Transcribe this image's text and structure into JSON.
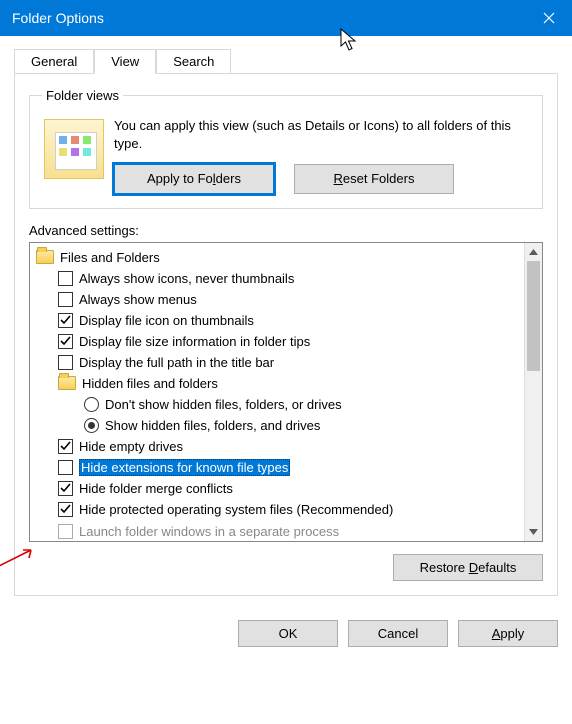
{
  "titlebar": {
    "title": "Folder Options"
  },
  "tabs": {
    "general": "General",
    "view": "View",
    "search": "Search"
  },
  "folder_views": {
    "legend": "Folder views",
    "desc": "You can apply this view (such as Details or Icons) to all folders of this type.",
    "apply_pre": "Apply to Fo",
    "apply_m": "l",
    "apply_post": "ders",
    "reset_m": "R",
    "reset_post": "eset Folders"
  },
  "advanced": {
    "label": "Advanced settings:",
    "group_files_folders": "Files and Folders",
    "items": [
      {
        "type": "check",
        "label": "Always show icons, never thumbnails",
        "checked": false
      },
      {
        "type": "check",
        "label": "Always show menus",
        "checked": false
      },
      {
        "type": "check",
        "label": "Display file icon on thumbnails",
        "checked": true
      },
      {
        "type": "check",
        "label": "Display file size information in folder tips",
        "checked": true
      },
      {
        "type": "check",
        "label": "Display the full path in the title bar",
        "checked": false
      }
    ],
    "group_hidden": "Hidden files and folders",
    "radios": [
      {
        "label": "Don't show hidden files, folders, or drives",
        "selected": false
      },
      {
        "label": "Show hidden files, folders, and drives",
        "selected": true
      }
    ],
    "items2": [
      {
        "type": "check",
        "label": "Hide empty drives",
        "checked": true
      },
      {
        "type": "check",
        "label": "Hide extensions for known file types",
        "checked": false,
        "highlighted": true
      },
      {
        "type": "check",
        "label": "Hide folder merge conflicts",
        "checked": true
      },
      {
        "type": "check",
        "label": "Hide protected operating system files (Recommended)",
        "checked": true
      }
    ],
    "overflow_item": "Launch folder windows in a separate process"
  },
  "restore": {
    "pre": "Restore ",
    "m": "D",
    "post": "efaults"
  },
  "dialog": {
    "ok": "OK",
    "cancel": "Cancel",
    "apply_m": "A",
    "apply_post": "pply"
  }
}
